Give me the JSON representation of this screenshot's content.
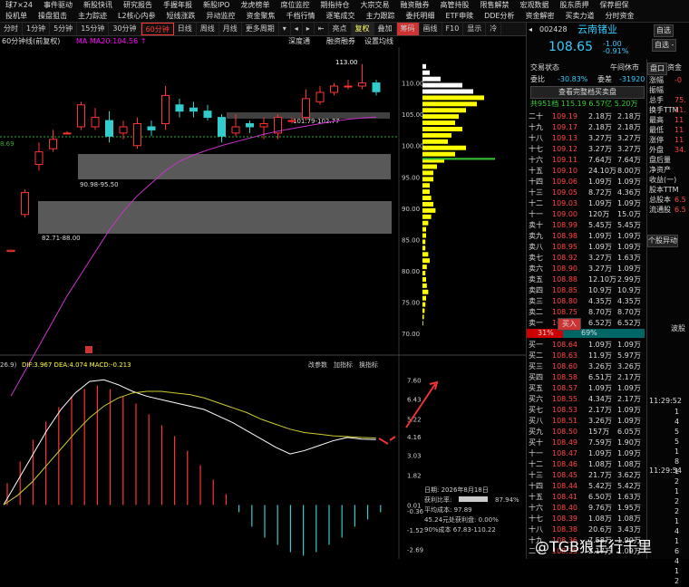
{
  "menubar": {
    "row1": [
      "球7×24",
      "事件驱动",
      "新股快讯",
      "研究报告",
      "手握年报",
      "新股IPO",
      "龙虎榜单",
      "席位监控",
      "期指持仓",
      "大宗交易",
      "融资融券",
      "高管持股",
      "限售解禁",
      "宏观数据",
      "股东质押",
      "保荐担保"
    ],
    "row2": [
      "投机单",
      "操盘狙击",
      "主力踪迹",
      "L2核心内参",
      "短线涨跌",
      "异动监控",
      "资金聚焦",
      "千档行情",
      "逐笔成交",
      "主力跟踪",
      "委托明细",
      "ETF申赎",
      "DDE分析",
      "资金解密",
      "买卖力道",
      "分时资金"
    ]
  },
  "toolbar": [
    "分时",
    "1分钟",
    "5分钟",
    "15分钟",
    "30分钟",
    "60分钟",
    "日线",
    "周线",
    "月线",
    "更多周期",
    "▾",
    "◂",
    "▸",
    "⇤",
    "亮点",
    "复权",
    "叠加",
    "筹码",
    "画线",
    "F10",
    "显示",
    "冷"
  ],
  "subbar": {
    "left": "60分钟线(前复权)",
    "ma": "MA  MA20:104.56 ↑",
    "tabs": [
      "深度通",
      "融资融券",
      "设置均线"
    ]
  },
  "price_axis": [
    "110.00",
    "105.00",
    "100.00",
    "95.00",
    "90.00",
    "85.00",
    "80.00",
    "75.00",
    "70.00"
  ],
  "price_labels": {
    "high": "113.00",
    "box1": "101.79-102.77",
    "box2": "90.98-95.50",
    "box3": "82.71-88.00",
    "left_price": "8.69"
  },
  "macd": {
    "label": "DIF:3.967  DEA:4.074  MACD:-0.213",
    "prefix": "26.9)",
    "tabs": [
      "改参数",
      "加指标",
      "换指标"
    ],
    "axis": [
      "7.60",
      "6.43",
      "5.22",
      "4.16",
      "3.03",
      "1.82",
      "0.01",
      "-0.36",
      "-1.52",
      "-2.69"
    ]
  },
  "chip": {
    "date": "日期: 2026年8月18日",
    "profit": "获利比率:",
    "profit_val": "87.94%",
    "avg_cost": "平均成本: 97.89",
    "zero": "45.24元处获利盘: 0.00%",
    "cost90": "90%成本 67.83-110.22"
  },
  "quote": {
    "code": "002428",
    "name": "云南锗业",
    "price": "108.65",
    "change": "-1.00",
    "pct": "-0.91%",
    "btn_self": "自选",
    "btn_add": "自选 -",
    "status": "交易状态",
    "status_val": "午间休市",
    "webi": "委比",
    "webi_val": "-30.83%",
    "weicha": "委差",
    "weicha_val": "-31920",
    "view_btn": "查看完整档买卖盘",
    "summary": "共951档 115.19  6.57亿  5.20万",
    "tabs": [
      "盘口",
      "资金"
    ]
  },
  "asks": [
    [
      "二十",
      "109.19",
      "2.18万",
      "2.18万"
    ],
    [
      "十九",
      "109.17",
      "2.18万",
      "2.18万"
    ],
    [
      "十八",
      "109.13",
      "3.27万",
      "3.27万"
    ],
    [
      "十七",
      "109.12",
      "3.27万",
      "3.27万"
    ],
    [
      "十六",
      "109.11",
      "7.64万",
      "7.64万"
    ],
    [
      "十五",
      "109.10",
      "24.10万",
      "8.00万"
    ],
    [
      "十四",
      "109.06",
      "1.09万",
      "1.09万"
    ],
    [
      "十三",
      "109.05",
      "8.72万",
      "4.36万"
    ],
    [
      "十二",
      "109.03",
      "1.09万",
      "1.09万"
    ],
    [
      "十一",
      "109.00",
      "120万",
      "15.0万"
    ],
    [
      "卖十",
      "108.99",
      "5.45万",
      "5.45万"
    ],
    [
      "卖九",
      "108.98",
      "1.09万",
      "1.09万"
    ],
    [
      "卖八",
      "108.95",
      "1.09万",
      "1.09万"
    ],
    [
      "卖七",
      "108.92",
      "3.27万",
      "1.63万"
    ],
    [
      "卖六",
      "108.90",
      "3.27万",
      "1.09万"
    ],
    [
      "卖五",
      "108.88",
      "12.10万",
      "2.99万"
    ],
    [
      "卖四",
      "108.85",
      "10.9万",
      "10.9万"
    ],
    [
      "卖三",
      "108.80",
      "4.35万",
      "4.35万"
    ],
    [
      "卖二",
      "108.75",
      "8.70万",
      "8.70万"
    ],
    [
      "卖一",
      "108.70",
      "6.52万",
      "6.52万"
    ]
  ],
  "bs_bar": {
    "label": "买入",
    "left": "31%",
    "right": "69%"
  },
  "bids": [
    [
      "买一",
      "108.64",
      "1.09万",
      "1.09万"
    ],
    [
      "买二",
      "108.63",
      "11.9万",
      "5.97万"
    ],
    [
      "买三",
      "108.60",
      "3.26万",
      "3.26万"
    ],
    [
      "买四",
      "108.58",
      "6.51万",
      "2.17万"
    ],
    [
      "买五",
      "108.57",
      "1.09万",
      "1.09万"
    ],
    [
      "买六",
      "108.55",
      "4.34万",
      "2.17万"
    ],
    [
      "买七",
      "108.53",
      "2.17万",
      "1.09万"
    ],
    [
      "买八",
      "108.51",
      "3.26万",
      "1.09万"
    ],
    [
      "买九",
      "108.50",
      "157万",
      "6.05万"
    ],
    [
      "买十",
      "108.49",
      "7.59万",
      "1.90万"
    ],
    [
      "十一",
      "108.47",
      "1.09万",
      "1.09万"
    ],
    [
      "十二",
      "108.46",
      "1.08万",
      "1.08万"
    ],
    [
      "十三",
      "108.45",
      "21.7万",
      "3.62万"
    ],
    [
      "十四",
      "108.44",
      "5.42万",
      "5.42万"
    ],
    [
      "十五",
      "108.41",
      "6.50万",
      "1.63万"
    ],
    [
      "十六",
      "108.40",
      "9.76万",
      "1.95万"
    ],
    [
      "十七",
      "108.39",
      "1.08万",
      "1.08万"
    ],
    [
      "十八",
      "108.38",
      "20.6万",
      "3.43万"
    ],
    [
      "十九",
      "108.36",
      "7.58万",
      "1.90万"
    ],
    [
      "二十",
      "108.35",
      "2.17万",
      "1.09万"
    ]
  ],
  "side": {
    "labels": [
      "涨幅",
      "振幅",
      "总手",
      "换手TTM",
      "最高",
      "最低",
      "涨停",
      "外盘",
      "盘后量",
      "净资产",
      "收益(一)",
      "股本TTM",
      "总股本",
      "流通股"
    ],
    "values": [
      "-0",
      "",
      "75.",
      "11.",
      "11",
      "11",
      "11",
      "34.",
      "",
      "",
      "",
      "",
      "6.5",
      "6.5"
    ],
    "alert": "个股异动",
    "times": [
      "11:29:52",
      "11:29:54"
    ],
    "right_label": "波股",
    "ticks": [
      "1",
      "4",
      "5",
      "5",
      "1",
      "8",
      "1",
      "2",
      "1",
      "2",
      "2",
      "1",
      "4",
      "1",
      "6",
      "4",
      "1",
      "2"
    ]
  },
  "watermark": "@TGB狼王行千里",
  "colors": {
    "up": "#ff3333",
    "down": "#33cccc",
    "ma20": "#cc33cc",
    "chip": "#ffff00",
    "dif": "#ffffff",
    "dea": "#cccc33"
  },
  "candles": [
    {
      "o": 83.1,
      "c": 83.3,
      "h": 83.4,
      "l": 83.0
    },
    {
      "o": 89.0,
      "c": 92.5,
      "h": 93.0,
      "l": 88.5
    },
    {
      "o": 97.0,
      "c": 99.0,
      "h": 100.5,
      "l": 96.0
    },
    {
      "o": 99.5,
      "c": 101.0,
      "h": 102.5,
      "l": 99.0
    },
    {
      "o": 102.0,
      "c": 102.0,
      "h": 102.3,
      "l": 101.8
    },
    {
      "o": 103.0,
      "c": 106.5,
      "h": 107.0,
      "l": 102.5
    },
    {
      "o": 103.0,
      "c": 104.5,
      "h": 106.0,
      "l": 102.5
    },
    {
      "o": 104.0,
      "c": 101.5,
      "h": 105.5,
      "l": 100.5
    },
    {
      "o": 102.0,
      "c": 103.0,
      "h": 104.0,
      "l": 101.0
    },
    {
      "o": 100.0,
      "c": 103.5,
      "h": 104.5,
      "l": 99.5
    },
    {
      "o": 103.0,
      "c": 102.5,
      "h": 104.0,
      "l": 101.5
    },
    {
      "o": 103.5,
      "c": 108.0,
      "h": 109.5,
      "l": 102.5
    },
    {
      "o": 106.5,
      "c": 105.5,
      "h": 107.5,
      "l": 104.5
    },
    {
      "o": 106.0,
      "c": 105.5,
      "h": 107.0,
      "l": 104.5
    },
    {
      "o": 105.5,
      "c": 104.5,
      "h": 106.5,
      "l": 104.0
    },
    {
      "o": 104.5,
      "c": 101.5,
      "h": 105.0,
      "l": 100.5
    },
    {
      "o": 102.0,
      "c": 103.0,
      "h": 105.0,
      "l": 101.5
    },
    {
      "o": 103.5,
      "c": 103.0,
      "h": 104.0,
      "l": 102.0
    },
    {
      "o": 103.0,
      "c": 103.5,
      "h": 104.5,
      "l": 101.0
    },
    {
      "o": 102.0,
      "c": 104.5,
      "h": 105.0,
      "l": 101.0
    },
    {
      "o": 104.0,
      "c": 104.0,
      "h": 104.5,
      "l": 103.5
    },
    {
      "o": 104.5,
      "c": 107.5,
      "h": 109.0,
      "l": 104.0
    },
    {
      "o": 107.0,
      "c": 108.5,
      "h": 109.5,
      "l": 106.5
    },
    {
      "o": 108.5,
      "c": 109.5,
      "h": 110.0,
      "l": 108.0
    },
    {
      "o": 109.5,
      "c": 109.5,
      "h": 110.5,
      "l": 109.0
    },
    {
      "o": 109.5,
      "c": 110.0,
      "h": 113.0,
      "l": 109.0
    },
    {
      "o": 110.0,
      "c": 108.6,
      "h": 110.5,
      "l": 108.0
    }
  ],
  "ma20": [
    60.0,
    64.0,
    68.0,
    72.0,
    76.0,
    79.5,
    83.0,
    86.5,
    89.5,
    92.0,
    94.0,
    96.0,
    97.5,
    98.5,
    99.3,
    100.0,
    100.6,
    101.2,
    101.8,
    102.3,
    102.7,
    103.1,
    103.5,
    103.9,
    104.2,
    104.4,
    104.56
  ],
  "macd_bars": [
    0.6,
    1.2,
    1.8,
    2.3,
    2.7,
    3.0,
    3.2,
    3.3,
    3.2,
    3.0,
    2.8,
    2.5,
    2.2,
    1.9,
    1.5,
    1.1,
    0.7,
    0.3,
    -0.2,
    -0.6,
    -0.9,
    -1.1,
    -1.3,
    -1.4,
    -1.3,
    -1.1,
    -0.9,
    -0.6,
    -0.4,
    -0.2
  ],
  "dif": [
    0.01,
    1.5,
    3.0,
    4.5,
    5.8,
    6.8,
    7.5,
    7.6,
    7.3,
    6.9,
    6.6,
    6.4,
    6.2,
    6.0,
    5.8,
    5.4,
    5.0,
    4.5,
    4.0,
    3.5,
    3.1,
    3.3,
    3.6,
    3.9,
    4.1,
    4.0,
    3.97
  ],
  "dea": [
    0.01,
    0.6,
    1.4,
    2.4,
    3.4,
    4.4,
    5.3,
    6.0,
    6.5,
    6.8,
    6.9,
    6.9,
    6.8,
    6.7,
    6.5,
    6.2,
    5.9,
    5.6,
    5.2,
    4.9,
    4.6,
    4.4,
    4.3,
    4.2,
    4.15,
    4.1,
    4.07
  ],
  "chips": [
    [
      113,
      0.05
    ],
    [
      112,
      0.1
    ],
    [
      111,
      0.25
    ],
    [
      110,
      0.55
    ],
    [
      109,
      0.7
    ],
    [
      108,
      0.85
    ],
    [
      107,
      0.75
    ],
    [
      106,
      0.6
    ],
    [
      105,
      0.5
    ],
    [
      104,
      0.45
    ],
    [
      103,
      0.55
    ],
    [
      102,
      0.4
    ],
    [
      101,
      0.35
    ],
    [
      100,
      0.6
    ],
    [
      99,
      0.45
    ],
    [
      98,
      0.3
    ],
    [
      97,
      0.2
    ],
    [
      96,
      0.15
    ],
    [
      95,
      0.15
    ],
    [
      94,
      0.1
    ],
    [
      93,
      0.1
    ],
    [
      92,
      0.12
    ],
    [
      91,
      0.15
    ],
    [
      90,
      0.18
    ],
    [
      89,
      0.12
    ],
    [
      88,
      0.08
    ],
    [
      87,
      0.05
    ],
    [
      86,
      0.05
    ],
    [
      85,
      0.04
    ],
    [
      84,
      0.04
    ],
    [
      83,
      0.08
    ],
    [
      82,
      0.1
    ],
    [
      81,
      0.06
    ],
    [
      80,
      0.04
    ],
    [
      79,
      0.05
    ],
    [
      78,
      0.06
    ],
    [
      77,
      0.08
    ],
    [
      76,
      0.05
    ],
    [
      75,
      0.04
    ],
    [
      74,
      0.03
    ],
    [
      73,
      0.02
    ],
    [
      72,
      0.01
    ]
  ]
}
